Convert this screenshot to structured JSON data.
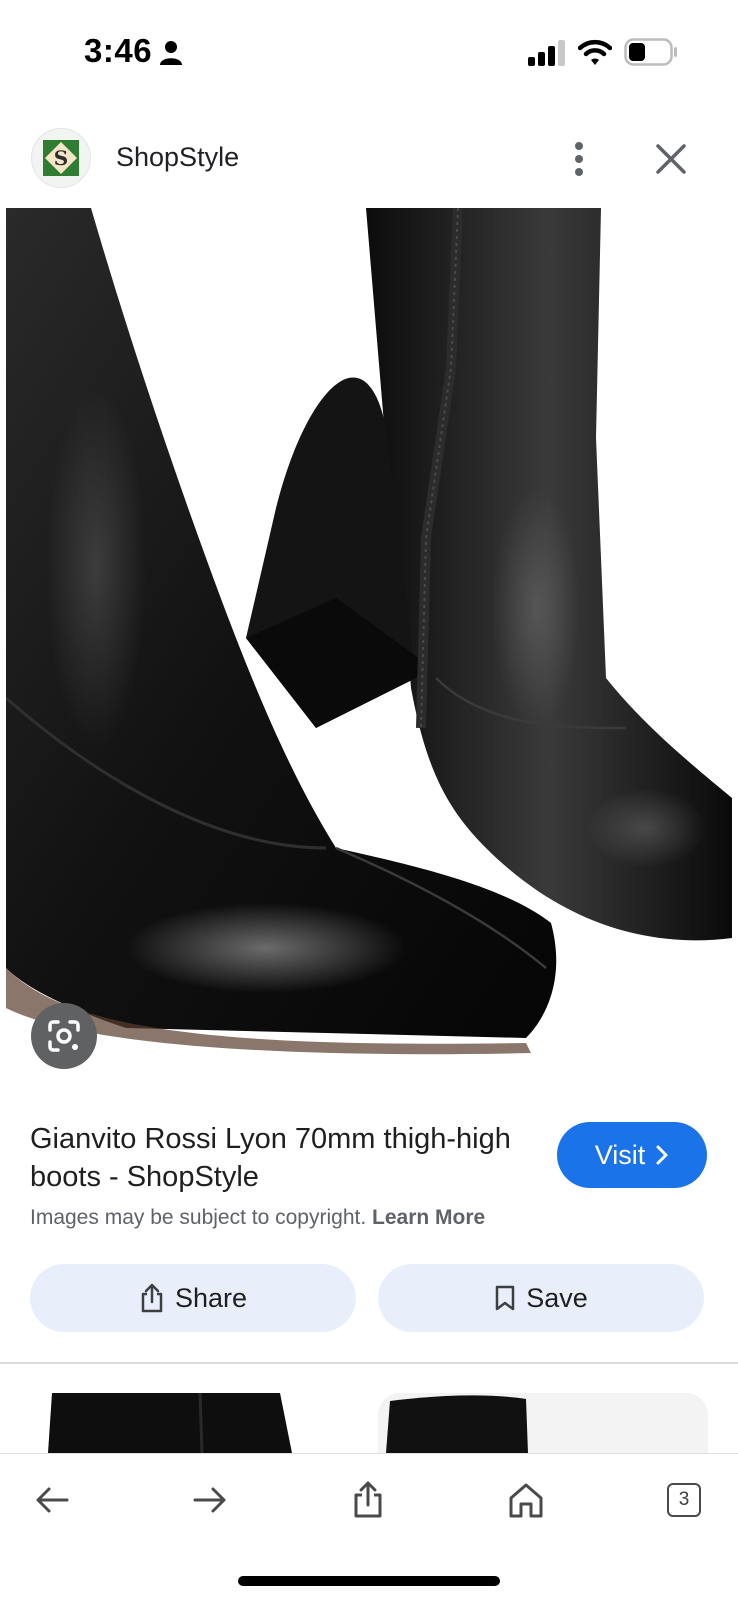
{
  "status_bar": {
    "time": "3:46"
  },
  "header": {
    "site_name": "ShopStyle",
    "logo_letter": "S"
  },
  "result": {
    "title": "Gianvito Rossi Lyon 70mm thigh-high boots - ShopStyle",
    "visit_label": "Visit",
    "copyright_text": "Images may be subject to copyright.",
    "learn_more_label": "Learn More",
    "share_label": "Share",
    "save_label": "Save"
  },
  "toolbar": {
    "tab_count": "3"
  },
  "icons": {
    "status": [
      "person-icon",
      "signal-icon",
      "wifi-icon",
      "battery-icon"
    ],
    "header": [
      "more-vert-icon",
      "close-icon"
    ],
    "image": [
      "lens-icon"
    ],
    "actions": [
      "chevron-right-icon",
      "share-icon",
      "bookmark-icon"
    ],
    "toolbar": [
      "back-arrow-icon",
      "forward-arrow-icon",
      "share-icon",
      "home-icon"
    ]
  },
  "colors": {
    "accent": "#1a73e8",
    "pill_background": "#e8effa",
    "lens_button": "#5f6163"
  }
}
